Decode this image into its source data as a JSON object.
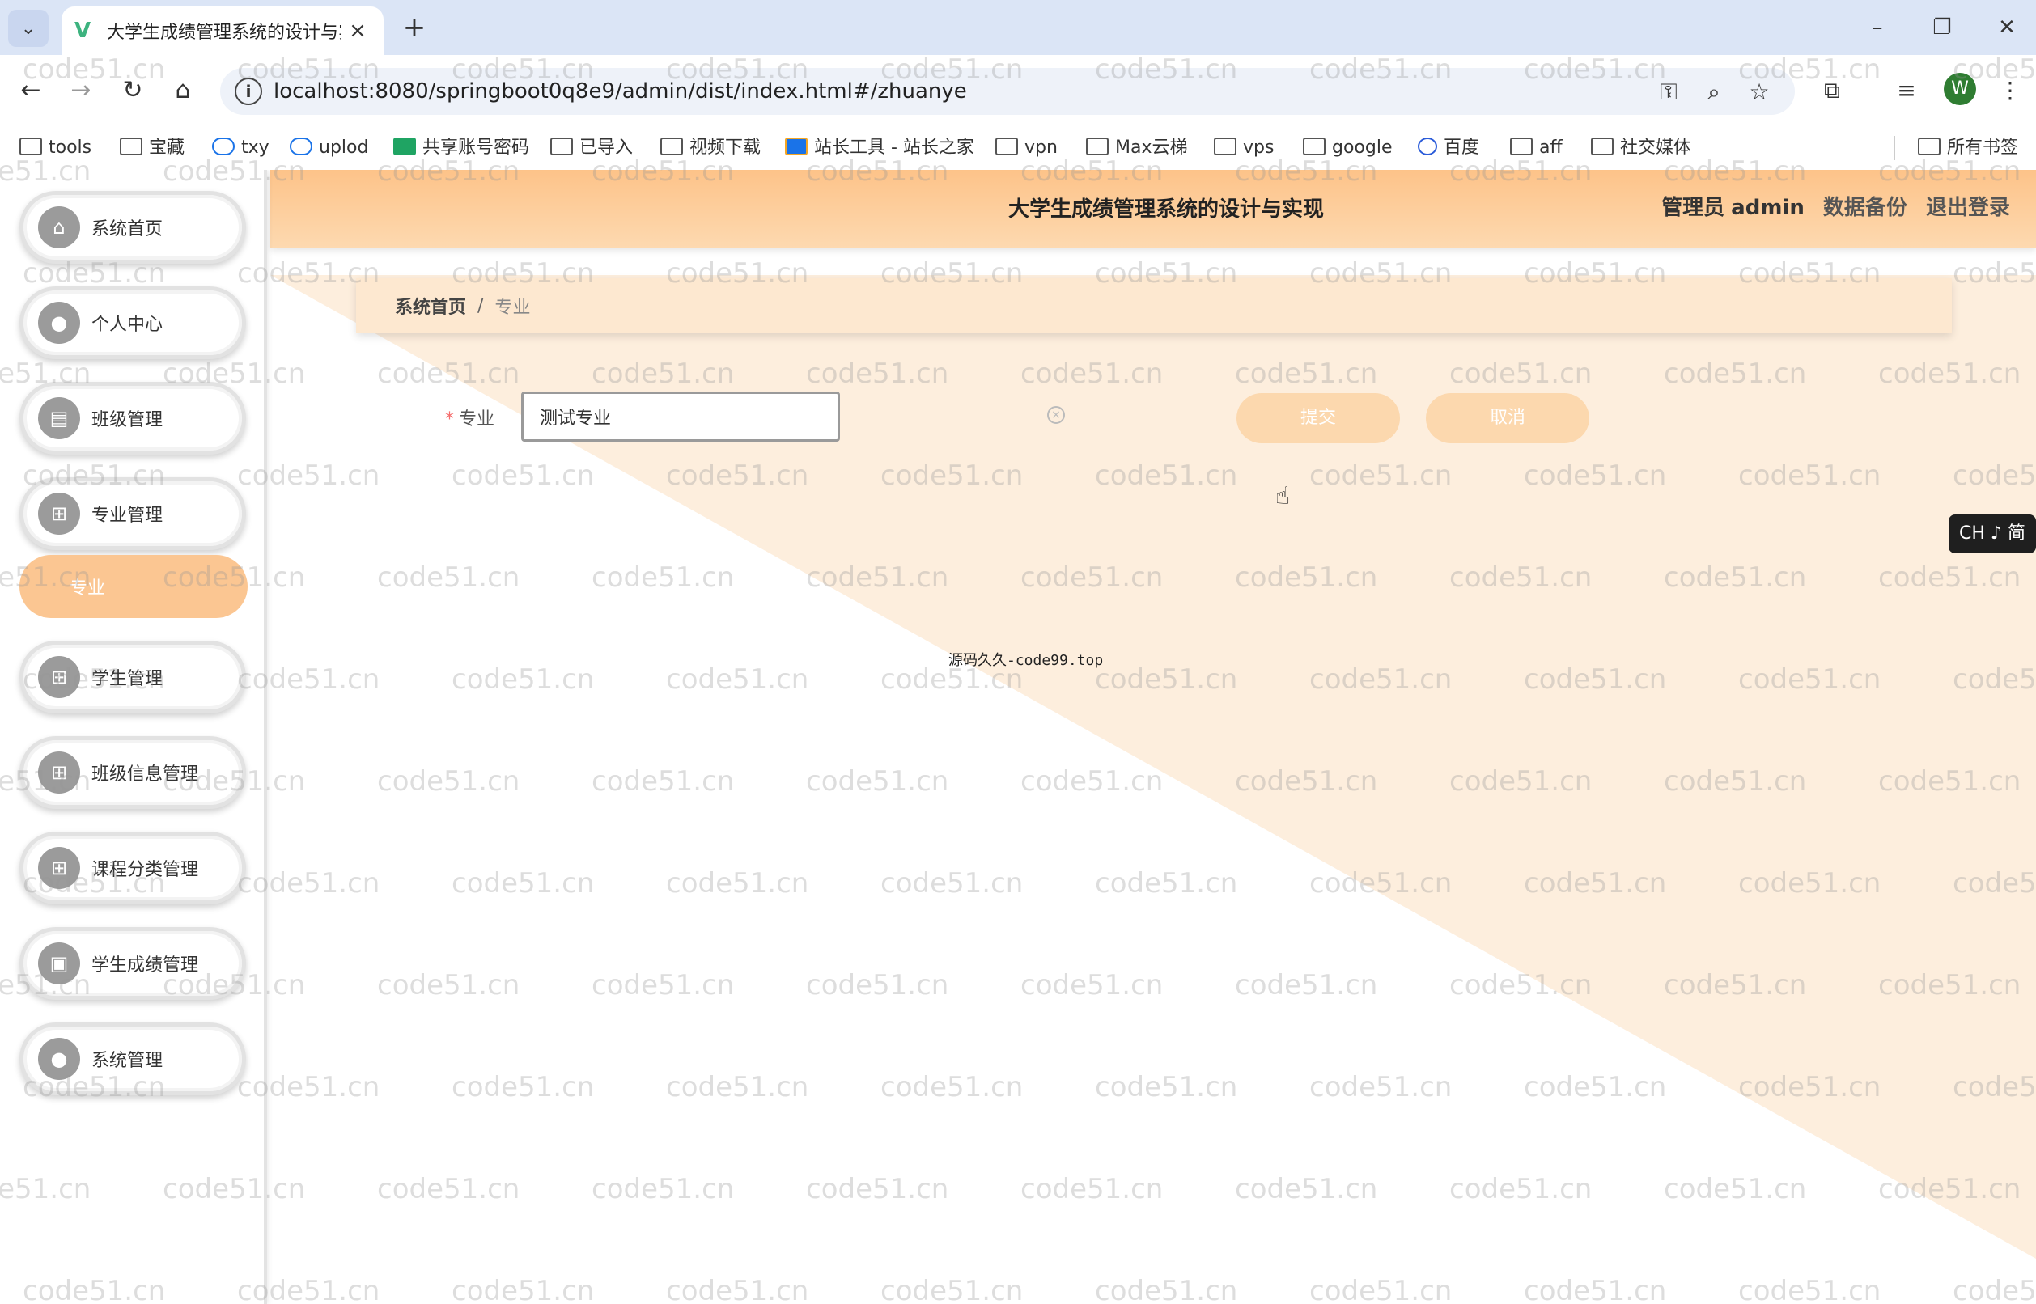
{
  "browser": {
    "tab_title": "大学生成绩管理系统的设计与实",
    "new_tab": "+",
    "url": "localhost:8080/springboot0q8e9/admin/dist/index.html#/zhuanye",
    "profile_initial": "W",
    "bookmarks": [
      {
        "label": "tools",
        "icon": "folder-icon"
      },
      {
        "label": "宝藏",
        "icon": "folder-icon"
      },
      {
        "label": "txy",
        "icon": "cloud-icon"
      },
      {
        "label": "uplod",
        "icon": "cloud-icon"
      },
      {
        "label": "共享账号密码",
        "icon": "sheet-icon"
      },
      {
        "label": "已导入",
        "icon": "folder-icon"
      },
      {
        "label": "视频下载",
        "icon": "folder-icon"
      },
      {
        "label": "站长工具 - 站长之家",
        "icon": "tool-icon"
      },
      {
        "label": "vpn",
        "icon": "folder-icon"
      },
      {
        "label": "Max云梯",
        "icon": "folder-icon"
      },
      {
        "label": "vps",
        "icon": "folder-icon"
      },
      {
        "label": "google",
        "icon": "folder-icon"
      },
      {
        "label": "百度",
        "icon": "paw-icon"
      },
      {
        "label": "aff",
        "icon": "folder-icon"
      },
      {
        "label": "社交媒体",
        "icon": "folder-icon"
      },
      {
        "label": "所有书签",
        "icon": "folder-icon"
      }
    ]
  },
  "sidebar": {
    "items": [
      {
        "label": "系统首页",
        "icon": "home-icon"
      },
      {
        "label": "个人中心",
        "icon": "user-icon"
      },
      {
        "label": "班级管理",
        "icon": "clipboard-icon"
      },
      {
        "label": "专业管理",
        "icon": "grid-icon"
      },
      {
        "label": "学生管理",
        "icon": "grid-icon"
      },
      {
        "label": "班级信息管理",
        "icon": "grid-icon"
      },
      {
        "label": "课程分类管理",
        "icon": "grid-icon"
      },
      {
        "label": "学生成绩管理",
        "icon": "briefcase-icon"
      },
      {
        "label": "系统管理",
        "icon": "user-icon"
      }
    ],
    "active_sub": "专业"
  },
  "header": {
    "title": "大学生成绩管理系统的设计与实现",
    "role": "管理员",
    "user": "admin",
    "backup": "数据备份",
    "logout": "退出登录"
  },
  "breadcrumb": {
    "home": "系统首页",
    "separator": "/",
    "current": "专业"
  },
  "form": {
    "label": "专业",
    "required_mark": "*",
    "value": "测试专业",
    "submit": "提交",
    "cancel": "取消"
  },
  "watermark_caption": "源码久久-code99.top",
  "watermark_repeat": "code51.cn",
  "ime": "CH ♪ 简",
  "colors": {
    "accent": "#fdc389",
    "accent_light": "#fde8d0",
    "button": "#fcd8ae",
    "active_menu": "#fbc692"
  }
}
